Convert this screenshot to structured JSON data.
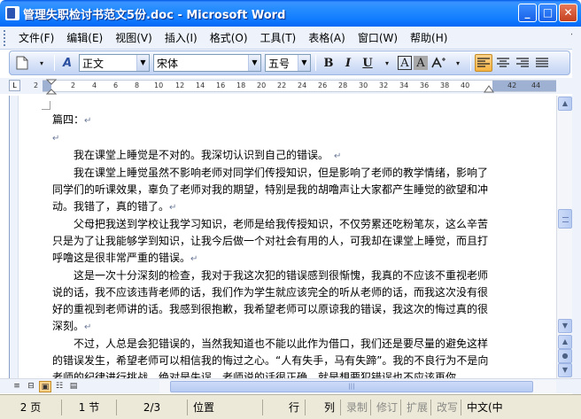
{
  "window": {
    "title": "管理失职检讨书范文5份.doc - Microsoft Word",
    "minimize": "_",
    "maximize": "□",
    "close": "✕"
  },
  "menu": {
    "items": [
      "文件(F)",
      "编辑(E)",
      "视图(V)",
      "插入(I)",
      "格式(O)",
      "工具(T)",
      "表格(A)",
      "窗口(W)",
      "帮助(H)"
    ],
    "more": "▾"
  },
  "toolbar": {
    "style_value": "正文",
    "font_value": "宋体",
    "size_value": "五号",
    "style_icon_text": "A",
    "bold": "B",
    "italic": "I",
    "underline": "U",
    "char_border": "A",
    "char_shade": "A"
  },
  "ruler": {
    "corner": "L",
    "ticks": [
      "2",
      "2",
      "4",
      "6",
      "8",
      "10",
      "12",
      "14",
      "16",
      "18",
      "20",
      "22",
      "24",
      "26",
      "28",
      "30",
      "32",
      "34",
      "36",
      "38",
      "40",
      "42",
      "44"
    ]
  },
  "document": {
    "paragraph_mark": "↵",
    "paragraphs": [
      "篇四：",
      "",
      "　　我在课堂上睡觉是不对的。我深切认识到自己的错误。　",
      "　　我在课堂上睡觉虽然不影响老师对同学们传授知识，但是影响了老师的教学情绪，影响了同学们的听课效果，辜负了老师对我的期望，特别是我的胡噜声让大家都产生睡觉的欲望和冲动。我错了，真的错了。",
      "　　父母把我送到学校让我学习知识，老师是给我传授知识，不仅劳累还吃粉笔灰，这么辛苦只是为了让我能够学到知识，让我今后做一个对社会有用的人，可我却在课堂上睡觉，而且打呼噜这是很非常严重的错误。",
      "　　这是一次十分深刻的检查，我对于我这次犯的错误感到很惭愧，我真的不应该不重视老师说的话，我不应该违背老师的话，我们作为学生就应该完全的听从老师的话，而我这次没有很好的重视到老师讲的话。我感到很抱歉，我希望老师可以原谅我的错误，我这次的悔过真的很深刻。",
      "　　不过，人总是会犯错误的，当然我知道也不能以此作为借口，我们还是要尽量的避免这样的错误发生，希望老师可以相信我的悔过之心。“人有失手，马有失蹄”。我的不良行为不是向老师的纪律进行挑战。绝对是失误，老师说的话很正确，就是想要犯错误也不应该再你"
    ]
  },
  "status": {
    "page": "2 页",
    "section": "1 节",
    "page_of": "2/3",
    "position": "位置",
    "line": "行",
    "column": "列",
    "record": "录制",
    "track": "修订",
    "extend": "扩展",
    "overtype": "改写",
    "language": "中文(中"
  },
  "scrollbar": {
    "up": "▲",
    "down": "▼",
    "prev_page": "▲",
    "browse": "●",
    "next_page": "▼",
    "hthumb_grip": "|||"
  }
}
